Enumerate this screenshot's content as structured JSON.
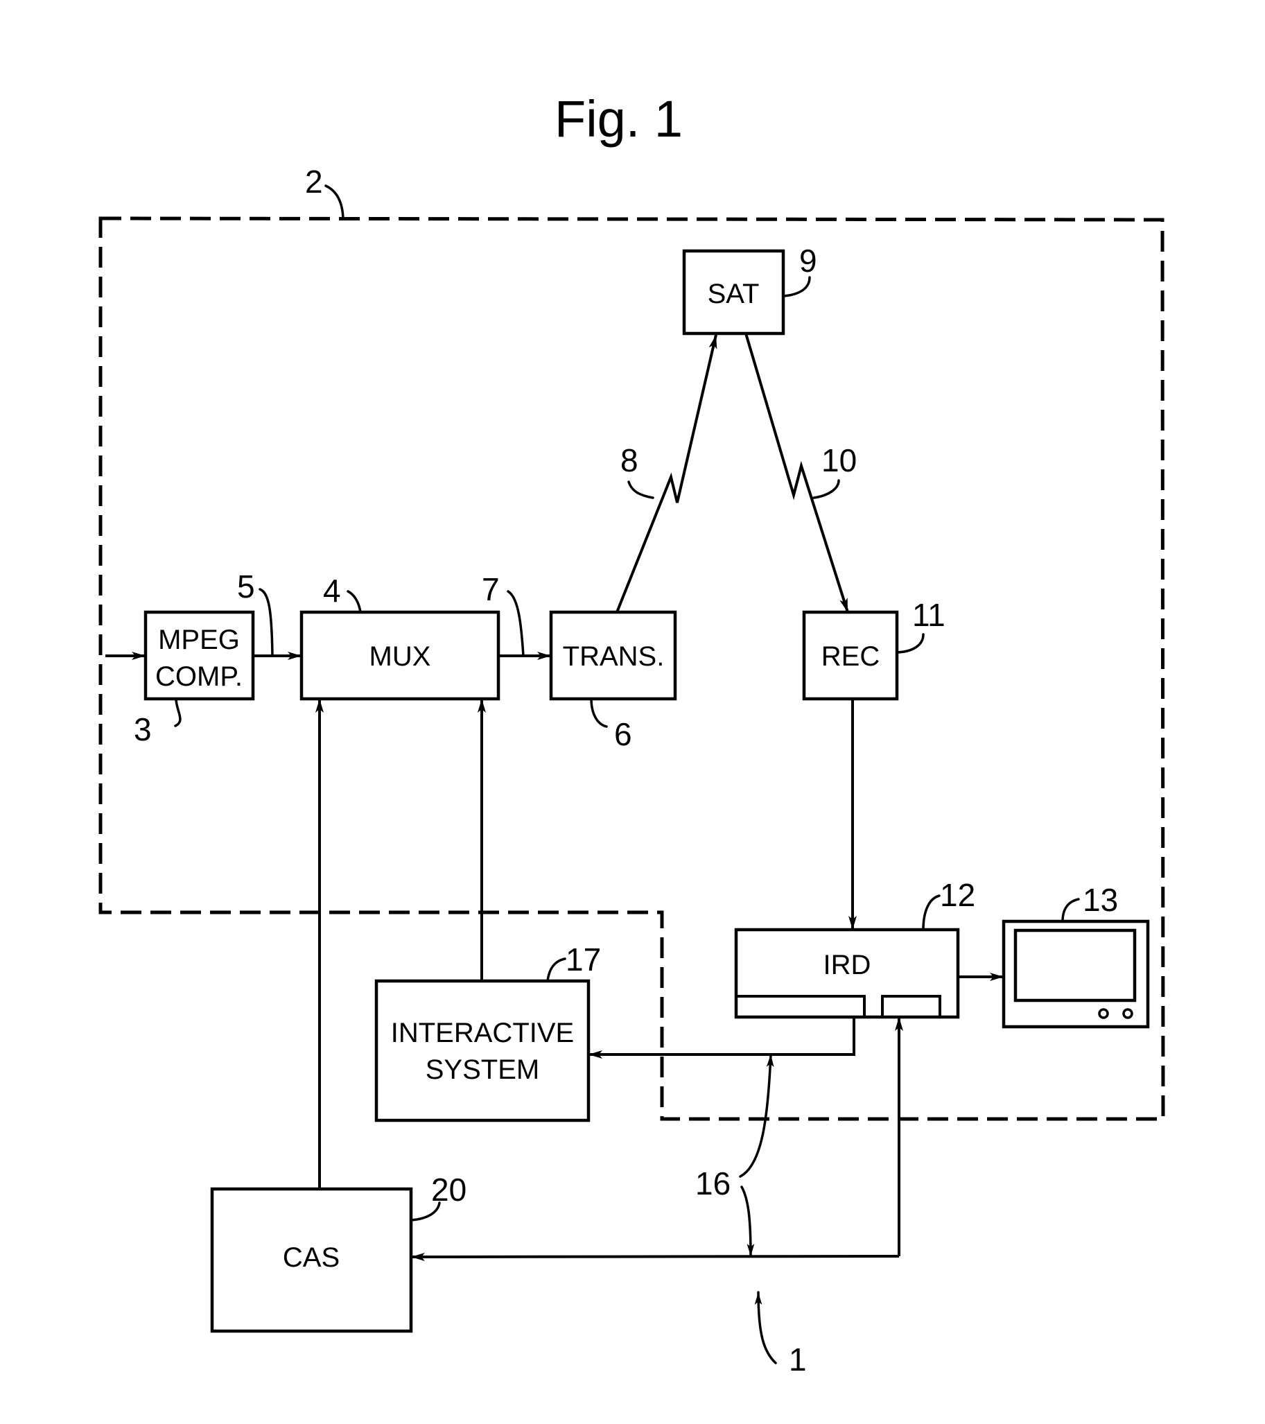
{
  "figure": {
    "title": "Fig. 1",
    "blocks": {
      "mpeg": {
        "line1": "MPEG",
        "line2": "COMP.",
        "ref": "3"
      },
      "mux": {
        "label": "MUX",
        "ref": "4"
      },
      "trans": {
        "label": "TRANS.",
        "ref": "6"
      },
      "sat": {
        "label": "SAT",
        "ref": "9"
      },
      "rec": {
        "label": "REC",
        "ref": "11"
      },
      "ird": {
        "label": "IRD",
        "ref": "12"
      },
      "tv": {
        "label": "",
        "ref": "13"
      },
      "interactive": {
        "line1": "INTERACTIVE",
        "line2": "SYSTEM",
        "ref": "17"
      },
      "cas": {
        "label": "CAS",
        "ref": "20"
      }
    },
    "refs": {
      "system": "1",
      "broadcast_region": "2",
      "link_mpeg_mux": "5",
      "link_mux_trans": "7",
      "uplink": "8",
      "downlink": "10",
      "return_channel": "16"
    }
  }
}
